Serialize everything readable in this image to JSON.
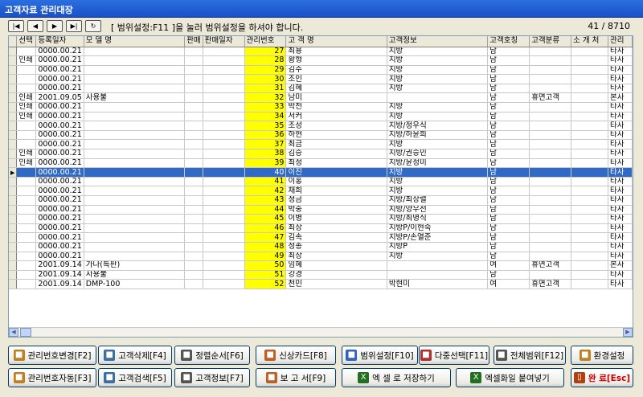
{
  "window": {
    "title": "고객자료 관리대장"
  },
  "toolbar": {
    "notice": "[ 범위설정:F11 ]을 눌러 범위설정을 하셔야 합니다.",
    "record_count": "41 / 8710"
  },
  "grid": {
    "columns": [
      "선택",
      "등록일자",
      "모 델 명",
      "판매",
      "판매일자",
      "관리번호",
      "고 객 명",
      "고객정보",
      "고객호칭",
      "고객분류",
      "소 개 처",
      "관리"
    ],
    "selected_row_index": 13,
    "rows": [
      [
        "",
        "0000.00.21",
        "",
        "",
        "",
        "27",
        "최용",
        "지방",
        "남",
        "",
        "",
        "타사"
      ],
      [
        "인쇄",
        "0000.00.21",
        "",
        "",
        "",
        "28",
        "황형",
        "지방",
        "남",
        "",
        "",
        "타사"
      ],
      [
        "",
        "0000.00.21",
        "",
        "",
        "",
        "29",
        "김주",
        "지방",
        "남",
        "",
        "",
        "타사"
      ],
      [
        "",
        "0000.00.21",
        "",
        "",
        "",
        "30",
        "조인",
        "지방",
        "남",
        "",
        "",
        "타사"
      ],
      [
        "",
        "0000.00.21",
        "",
        "",
        "",
        "31",
        "김혜",
        "지방",
        "남",
        "",
        "",
        "타사"
      ],
      [
        "인쇄",
        "2001.09.05",
        "사용불",
        "",
        "",
        "32",
        "남미",
        "",
        "남",
        "휴면고객",
        "",
        "본사"
      ],
      [
        "인쇄",
        "0000.00.21",
        "",
        "",
        "",
        "33",
        "박천",
        "지방",
        "남",
        "",
        "",
        "타사"
      ],
      [
        "인쇄",
        "0000.00.21",
        "",
        "",
        "",
        "34",
        "서커",
        "지방",
        "남",
        "",
        "",
        "타사"
      ],
      [
        "",
        "0000.00.21",
        "",
        "",
        "",
        "35",
        "조성",
        "지방/정우식",
        "남",
        "",
        "",
        "타사"
      ],
      [
        "",
        "0000.00.21",
        "",
        "",
        "",
        "36",
        "하현",
        "지방/하윤희",
        "남",
        "",
        "",
        "타사"
      ],
      [
        "",
        "0000.00.21",
        "",
        "",
        "",
        "37",
        "최금",
        "지방",
        "남",
        "",
        "",
        "타사"
      ],
      [
        "인쇄",
        "0000.00.21",
        "",
        "",
        "",
        "38",
        "김증",
        "지방/권승민",
        "남",
        "",
        "",
        "타사"
      ],
      [
        "인쇄",
        "0000.00.21",
        "",
        "",
        "",
        "39",
        "최정",
        "지방/윤정미",
        "남",
        "",
        "",
        "타사"
      ],
      [
        "",
        "0000.00.21",
        "",
        "",
        "",
        "40",
        "이진",
        "지방",
        "남",
        "",
        "",
        "타사"
      ],
      [
        "",
        "0000.00.21",
        "",
        "",
        "",
        "41",
        "이홍",
        "지방",
        "남",
        "",
        "",
        "타사"
      ],
      [
        "",
        "0000.00.21",
        "",
        "",
        "",
        "42",
        "채희",
        "지방",
        "남",
        "",
        "",
        "타사"
      ],
      [
        "",
        "0000.00.21",
        "",
        "",
        "",
        "43",
        "정금",
        "지방/최상렬",
        "남",
        "",
        "",
        "타사"
      ],
      [
        "",
        "0000.00.21",
        "",
        "",
        "",
        "44",
        "박중",
        "지방/양우선",
        "남",
        "",
        "",
        "타사"
      ],
      [
        "",
        "0000.00.21",
        "",
        "",
        "",
        "45",
        "이병",
        "지방/최명식",
        "남",
        "",
        "",
        "타사"
      ],
      [
        "",
        "0000.00.21",
        "",
        "",
        "",
        "46",
        "최상",
        "지방P/이현숙",
        "남",
        "",
        "",
        "타사"
      ],
      [
        "",
        "0000.00.21",
        "",
        "",
        "",
        "47",
        "김속",
        "지방P/손열준",
        "남",
        "",
        "",
        "타사"
      ],
      [
        "",
        "0000.00.21",
        "",
        "",
        "",
        "48",
        "정종",
        "지방P",
        "남",
        "",
        "",
        "타사"
      ],
      [
        "",
        "0000.00.21",
        "",
        "",
        "",
        "49",
        "최상",
        "지방",
        "남",
        "",
        "",
        "타사"
      ],
      [
        "",
        "2001.09.14",
        "가나(특판)",
        "",
        "",
        "50",
        "임혜",
        "",
        "여",
        "휴면고객",
        "",
        "본사"
      ],
      [
        "",
        "2001.09.14",
        "사용불",
        "",
        "",
        "51",
        "강경",
        "",
        "남",
        "",
        "",
        "타사"
      ],
      [
        "",
        "2001.09.14",
        "DMP-100",
        "",
        "",
        "52",
        "천민",
        "박현미",
        "여",
        "휴면고객",
        "",
        "타사"
      ]
    ]
  },
  "buttons": [
    {
      "name": "change-id-button",
      "label": "관리번호변경[F2]",
      "icon": "wrench-icon",
      "color": "#c08020"
    },
    {
      "name": "delete-customer-button",
      "label": "고객삭제[F4]",
      "icon": "user-delete-icon",
      "color": "#3a6ea5"
    },
    {
      "name": "sort-order-button",
      "label": "정렬순서[F6]",
      "icon": "list-icon",
      "color": "#555555"
    },
    {
      "name": "credit-card-button",
      "label": "신상카드[F8]",
      "icon": "person-card-icon",
      "color": "#c06020"
    },
    {
      "name": "range-setting-button",
      "label": "범위설정[F10]",
      "icon": "range-icon",
      "color": "#3060c0"
    },
    {
      "name": "multi-select-button",
      "label": "다중선택[F11]",
      "icon": "multi-select-icon",
      "color": "#b03030"
    },
    {
      "name": "full-range-button",
      "label": "전체범위[F12]",
      "icon": "document-icon",
      "color": "#555555"
    },
    {
      "name": "environment-button",
      "label": "환경설정",
      "icon": "tools-icon",
      "color": "#c08020"
    },
    {
      "name": "auto-id-button",
      "label": "관리번호자동[F3]",
      "icon": "wrench-icon",
      "color": "#c08020"
    },
    {
      "name": "search-customer-button",
      "label": "고객검색[F5]",
      "icon": "user-search-icon",
      "color": "#3a6ea5"
    },
    {
      "name": "customer-info-button",
      "label": "고객정보[F7]",
      "icon": "info-icon",
      "color": "#555555"
    },
    {
      "name": "report-button",
      "label": "보 고 서[F9]",
      "icon": "report-icon",
      "color": "#c06020"
    },
    {
      "name": "export-excel-button",
      "label": "엑 셀 로 저장하기",
      "icon": "excel-icon",
      "color": "#207020"
    },
    {
      "name": "paste-excel-button",
      "label": "엑셀화일 붙여넣기",
      "icon": "excel-icon",
      "color": "#207020"
    },
    {
      "name": "finish-button",
      "label": "완 료[Esc]",
      "icon": "door-icon",
      "color": "#b04010"
    }
  ]
}
